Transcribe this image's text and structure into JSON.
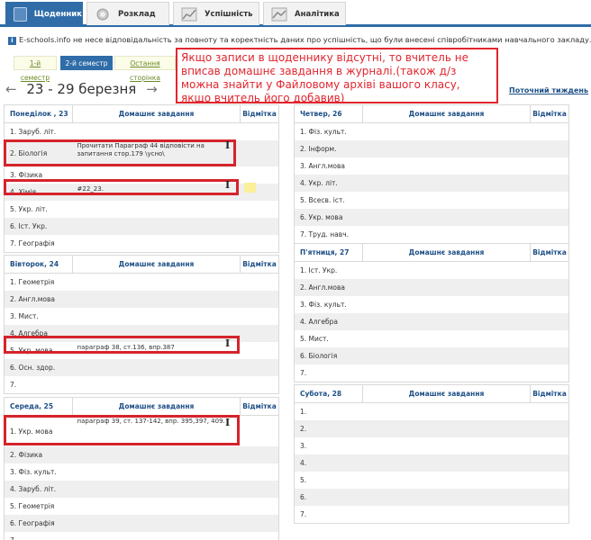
{
  "tabs": [
    {
      "label": "Щоденник",
      "active": true,
      "icon": "diary-icon"
    },
    {
      "label": "Розклад",
      "active": false,
      "icon": "schedule-icon"
    },
    {
      "label": "Успішність",
      "active": false,
      "icon": "progress-chart-icon"
    },
    {
      "label": "Аналітика",
      "active": false,
      "icon": "analytics-icon"
    }
  ],
  "notice": "E-schools.info не несе відповідальність за повноту та коректність даних про успішність, що були внесені співробітниками навчального закладу.",
  "semesters": [
    "1-й семестр",
    "2-й семестр",
    "Остання сторінка"
  ],
  "active_semester": "2-й семестр",
  "week": {
    "range": "23 - 29 березня",
    "prev": "←",
    "next": "→",
    "current_link": "Поточний тиждень"
  },
  "annotation": "Якщо записи в щоденнику відсутні, то вчитель не вписав домашнє завдання в журналі.(також д/з можна знайти у Файловому архіві вашого класу, якщо вчитель його добавив)",
  "columns": {
    "homework": "Домашнє завдання",
    "mark": "Відмітка"
  },
  "days": {
    "mon": {
      "title": "Понеділок , 23",
      "rows": [
        {
          "subject": "1. Заруб. літ.",
          "hw": ""
        },
        {
          "subject": "2. Біологія",
          "hw": "Прочитати Параграф 44 відповісти на запитання стор.179 \\усно\\"
        },
        {
          "subject": "3. Фізика",
          "hw": ""
        },
        {
          "subject": "4. Хімія",
          "hw": "#22_23."
        },
        {
          "subject": "5. Укр. літ.",
          "hw": ""
        },
        {
          "subject": "6. Іст. Укр.",
          "hw": ""
        },
        {
          "subject": "7. Географія",
          "hw": ""
        }
      ]
    },
    "tue": {
      "title": "Вівторок, 24",
      "rows": [
        {
          "subject": "1. Геометрія",
          "hw": ""
        },
        {
          "subject": "2. Англ.мова",
          "hw": ""
        },
        {
          "subject": "3. Мист.",
          "hw": ""
        },
        {
          "subject": "4. Алгебра",
          "hw": ""
        },
        {
          "subject": "5. Укр. мова",
          "hw": "параграф 38, ст.136, впр.387"
        },
        {
          "subject": "6. Осн. здор.",
          "hw": ""
        },
        {
          "subject": "7.",
          "hw": ""
        }
      ]
    },
    "wed": {
      "title": "Середа, 25",
      "rows": [
        {
          "subject": "1. Укр. мова",
          "hw": "параграф 39, ст. 137-142, впр. 395,397, 409."
        },
        {
          "subject": "2. Фізика",
          "hw": ""
        },
        {
          "subject": "3. Фіз. культ.",
          "hw": ""
        },
        {
          "subject": "4. Заруб. літ.",
          "hw": ""
        },
        {
          "subject": "5. Геометрія",
          "hw": ""
        },
        {
          "subject": "6. Географія",
          "hw": ""
        },
        {
          "subject": "7.",
          "hw": ""
        }
      ]
    },
    "thu": {
      "title": "Четвер, 26",
      "rows": [
        {
          "subject": "1. Фіз. культ.",
          "hw": ""
        },
        {
          "subject": "2. Інформ.",
          "hw": ""
        },
        {
          "subject": "3. Англ.мова",
          "hw": ""
        },
        {
          "subject": "4. Укр. літ.",
          "hw": ""
        },
        {
          "subject": "5. Всесв. іст.",
          "hw": ""
        },
        {
          "subject": "6. Укр. мова",
          "hw": ""
        },
        {
          "subject": "7. Труд. навч.",
          "hw": ""
        }
      ]
    },
    "fri": {
      "title": "П'ятниця, 27",
      "rows": [
        {
          "subject": "1. Іст. Укр.",
          "hw": ""
        },
        {
          "subject": "2. Англ.мова",
          "hw": ""
        },
        {
          "subject": "3. Фіз. культ.",
          "hw": ""
        },
        {
          "subject": "4. Алгебра",
          "hw": ""
        },
        {
          "subject": "5. Мист.",
          "hw": ""
        },
        {
          "subject": "6. Біологія",
          "hw": ""
        },
        {
          "subject": "7.",
          "hw": ""
        }
      ]
    },
    "sat": {
      "title": "Субота, 28",
      "rows": [
        {
          "subject": "1.",
          "hw": ""
        },
        {
          "subject": "2.",
          "hw": ""
        },
        {
          "subject": "3.",
          "hw": ""
        },
        {
          "subject": "4.",
          "hw": ""
        },
        {
          "subject": "5.",
          "hw": ""
        },
        {
          "subject": "6.",
          "hw": ""
        },
        {
          "subject": "7.",
          "hw": ""
        }
      ]
    }
  },
  "colors": {
    "brand": "#2f6ca8",
    "highlight": "#d5232b",
    "annotation": "#e0262e"
  }
}
